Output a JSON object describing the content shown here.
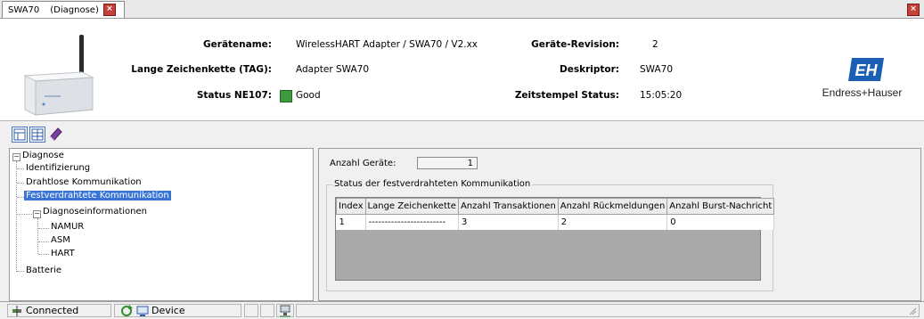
{
  "tab": {
    "device": "SWA70",
    "view": "(Diagnose)"
  },
  "header": {
    "rows": [
      {
        "label": "Gerätename:",
        "value": "WirelessHART Adapter / SWA70 / V2.xx",
        "label2": "Geräte-Revision:",
        "value2": "2"
      },
      {
        "label": "Lange Zeichenkette (TAG):",
        "value": "Adapter SWA70",
        "label2": "Deskriptor:",
        "value2": "SWA70"
      },
      {
        "label": "Status NE107:",
        "value": "Good",
        "label2": "Zeitstempel Status:",
        "value2": "15:05:20"
      }
    ],
    "status_color": "#3f9a3f",
    "logo_text": "Endress+Hauser",
    "logo_color": "#1a5fb4"
  },
  "tree": {
    "root": "Diagnose",
    "items": [
      "Identifizierung",
      "Drahtlose Kommunikation",
      "Festverdrahtete Kommunikation"
    ],
    "subgroup": "Diagnoseinformationen",
    "subitems": [
      "NAMUR",
      "ASM",
      "HART"
    ],
    "last": "Batterie",
    "selected": "Festverdrahtete Kommunikation"
  },
  "main": {
    "count_label": "Anzahl Geräte:",
    "count_value": "1",
    "group_title": "Status der festverdrahteten Kommunikation",
    "columns": [
      "Index",
      "Lange Zeichenkette",
      "Anzahl Transaktionen",
      "Anzahl Rückmeldungen",
      "Anzahl Burst-Nachricht"
    ],
    "rows": [
      [
        "1",
        "------------------------",
        "3",
        "2",
        "0"
      ]
    ]
  },
  "statusbar": {
    "connected": "Connected",
    "device": "Device"
  }
}
